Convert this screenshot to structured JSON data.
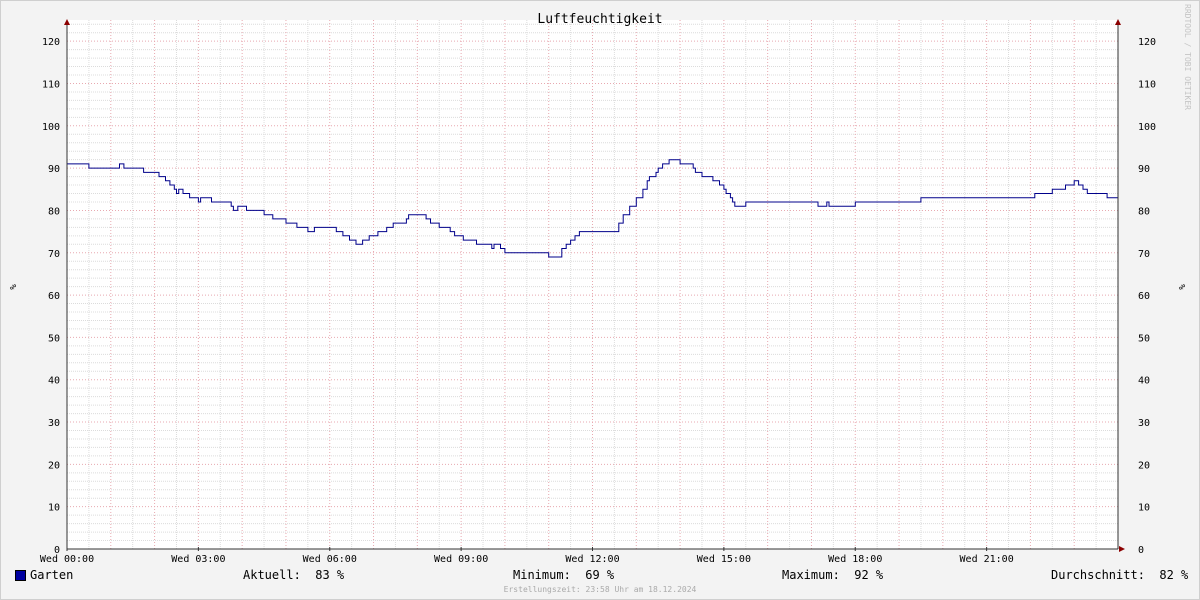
{
  "chart_data": {
    "type": "line",
    "title": "Luftfeuchtigkeit",
    "ylabel": "%",
    "ylim": [
      0,
      125
    ],
    "y_ticks": [
      0,
      10,
      20,
      30,
      40,
      50,
      60,
      70,
      80,
      90,
      100,
      110,
      120
    ],
    "x_unit": "hours",
    "xlim": [
      0,
      24
    ],
    "x_ticks": [
      {
        "x": 0,
        "label": "Wed 00:00"
      },
      {
        "x": 3,
        "label": "Wed 03:00"
      },
      {
        "x": 6,
        "label": "Wed 06:00"
      },
      {
        "x": 9,
        "label": "Wed 09:00"
      },
      {
        "x": 12,
        "label": "Wed 12:00"
      },
      {
        "x": 15,
        "label": "Wed 15:00"
      },
      {
        "x": 18,
        "label": "Wed 18:00"
      },
      {
        "x": 21,
        "label": "Wed 21:00"
      }
    ],
    "grid": true,
    "legend_position": "bottom",
    "series": [
      {
        "name": "Garten",
        "color": "#00008b",
        "x": [
          0,
          0.45,
          0.5,
          1.15,
          1.2,
          1.3,
          1.7,
          1.75,
          2.0,
          2.1,
          2.25,
          2.35,
          2.45,
          2.5,
          2.55,
          2.65,
          2.8,
          2.9,
          3.0,
          3.05,
          3.3,
          3.35,
          3.45,
          3.7,
          3.75,
          3.8,
          3.9,
          4.1,
          4.2,
          4.5,
          4.6,
          4.7,
          4.85,
          5.0,
          5.15,
          5.25,
          5.5,
          5.65,
          5.75,
          5.85,
          6.0,
          6.15,
          6.3,
          6.45,
          6.6,
          6.75,
          6.9,
          7.1,
          7.3,
          7.45,
          7.75,
          7.8,
          7.85,
          7.9,
          8.0,
          8.15,
          8.2,
          8.3,
          8.5,
          8.75,
          8.85,
          9.0,
          9.05,
          9.1,
          9.2,
          9.35,
          9.7,
          9.75,
          9.9,
          10.0,
          10.1,
          10.2,
          10.5,
          11.0,
          11.3,
          11.4,
          11.5,
          11.6,
          11.7,
          11.8,
          11.85,
          11.95,
          12.05,
          12.1,
          12.2,
          12.35,
          12.5,
          12.6,
          12.7,
          12.85,
          13.0,
          13.15,
          13.25,
          13.3,
          13.45,
          13.5,
          13.6,
          13.65,
          13.75,
          14.0,
          14.3,
          14.35,
          14.5,
          14.65,
          14.75,
          14.8,
          14.9,
          15.0,
          15.05,
          15.15,
          15.2,
          15.25,
          15.3,
          15.35,
          15.4,
          15.5,
          17.15,
          17.2,
          17.3,
          17.35,
          17.4,
          18.0,
          18.5,
          18.55,
          19.5,
          21.8,
          21.9,
          22.0,
          22.1,
          22.5,
          22.8,
          22.9,
          23.0,
          23.1,
          23.2,
          23.3,
          23.5,
          23.75,
          24.0
        ],
        "y": [
          91,
          91,
          90,
          90,
          91,
          90,
          90,
          89,
          89,
          88,
          87,
          86,
          85,
          84,
          85,
          84,
          83,
          83,
          82,
          83,
          82,
          82,
          82,
          82,
          81,
          80,
          81,
          80,
          80,
          79,
          79,
          78,
          78,
          77,
          77,
          76,
          75,
          76,
          76,
          76,
          76,
          75,
          74,
          73,
          72,
          73,
          74,
          75,
          76,
          77,
          78,
          79,
          79,
          79,
          79,
          79,
          78,
          77,
          76,
          75,
          74,
          74,
          73,
          73,
          73,
          72,
          71,
          72,
          71,
          70,
          70,
          70,
          70,
          69,
          71,
          72,
          73,
          74,
          75,
          75,
          75,
          75,
          75,
          75,
          75,
          75,
          75,
          77,
          79,
          81,
          83,
          85,
          87,
          88,
          89,
          90,
          91,
          91,
          92,
          91,
          90,
          89,
          88,
          88,
          87,
          87,
          86,
          85,
          84,
          83,
          82,
          81,
          81,
          81,
          81,
          82,
          81,
          81,
          81,
          82,
          81,
          82,
          82,
          82,
          83,
          83,
          83,
          83,
          84,
          85,
          86,
          86,
          87,
          86,
          85,
          84,
          84,
          83,
          83
        ]
      }
    ]
  },
  "legend": {
    "series_name": "Garten",
    "aktuell": "Aktuell:  83 %",
    "minimum": "Minimum:  69 %",
    "maximum": "Maximum:  92 %",
    "durchschnitt": "Durchschnitt:  82 %"
  },
  "footer": "Erstellungszeit: 23:58 Uhr am 18.12.2024",
  "watermark": "RRDTOOL / TOBI OETIKER"
}
